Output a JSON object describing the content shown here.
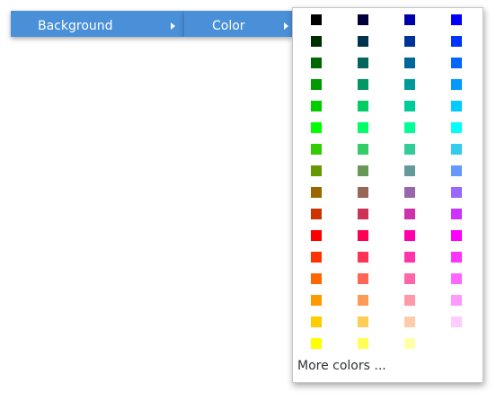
{
  "menu": {
    "background_label": "Background",
    "color_label": "Color"
  },
  "palette": {
    "more_colors_label": "More colors ...",
    "swatches": [
      [
        "#000000",
        "#00003d",
        "#0000a8",
        "#0000ff"
      ],
      [
        "#002e00",
        "#00334d",
        "#003399",
        "#0033ff"
      ],
      [
        "#006600",
        "#00665e",
        "#006699",
        "#0066ff"
      ],
      [
        "#009900",
        "#009966",
        "#009999",
        "#0099ff"
      ],
      [
        "#00cc00",
        "#00cc66",
        "#00cc99",
        "#00ccff"
      ],
      [
        "#00ff00",
        "#00ff66",
        "#00ff99",
        "#00ffff"
      ],
      [
        "#33cc00",
        "#33cc66",
        "#33cc99",
        "#33ccee"
      ],
      [
        "#669900",
        "#669955",
        "#669999",
        "#6699ff"
      ],
      [
        "#996600",
        "#996655",
        "#9966aa",
        "#9966ff"
      ],
      [
        "#cc3300",
        "#cc3355",
        "#cc33aa",
        "#cc33ff"
      ],
      [
        "#ff0000",
        "#ff0055",
        "#ff00aa",
        "#ff00ff"
      ],
      [
        "#ff3300",
        "#ff3355",
        "#ff33aa",
        "#ff33ff"
      ],
      [
        "#ff6600",
        "#ff6655",
        "#ff66aa",
        "#ff66ff"
      ],
      [
        "#ff9900",
        "#ff9955",
        "#ff99aa",
        "#ff99ff"
      ],
      [
        "#ffcc00",
        "#ffcc55",
        "#ffccaa",
        "#ffccff"
      ],
      [
        "#ffff00",
        "#ffff55",
        "#ffffaa",
        null
      ]
    ]
  }
}
